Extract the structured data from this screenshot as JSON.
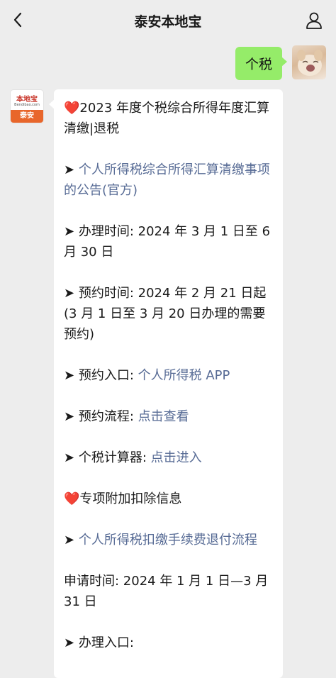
{
  "header": {
    "title": "泰安本地宝"
  },
  "my_message": {
    "text": "个税"
  },
  "bot_avatar": {
    "top_text": "本地宝",
    "url_text": "Bendibao.com",
    "bottom_text": "泰安"
  },
  "bubble": {
    "item1_heart": "❤️",
    "item1_text": "2023 年度个税综合所得年度汇算清缴|退税",
    "item2_arrow": "➤",
    "item2_link": "个人所得税综合所得汇算清缴事项的公告(官方)",
    "item3_arrow": "➤",
    "item3_text": "办理时间: 2024 年 3 月 1 日至 6 月 30 日",
    "item4_arrow": "➤",
    "item4_text": "预约时间: 2024 年 2 月 21 日起(3 月 1 日至 3 月 20 日办理的需要预约)",
    "item5_arrow": "➤",
    "item5_label": "预约入口: ",
    "item5_link": "个人所得税 APP",
    "item6_arrow": "➤",
    "item6_label": "预约流程: ",
    "item6_link": "点击查看",
    "item7_arrow": "➤",
    "item7_label": "个税计算器: ",
    "item7_link": "点击进入",
    "item8_heart": "❤️",
    "item8_text": "专项附加扣除信息",
    "item9_arrow": "➤",
    "item9_link": "个人所得税扣缴手续费退付流程",
    "item10_text": "申请时间: 2024 年 1 月 1 日—3 月 31 日",
    "item11_arrow": "➤",
    "item11_label": "办理入口:"
  },
  "colors": {
    "background": "#ededed",
    "my_bubble": "#95ec69",
    "link": "#576b95",
    "heart": "#e3222d"
  }
}
